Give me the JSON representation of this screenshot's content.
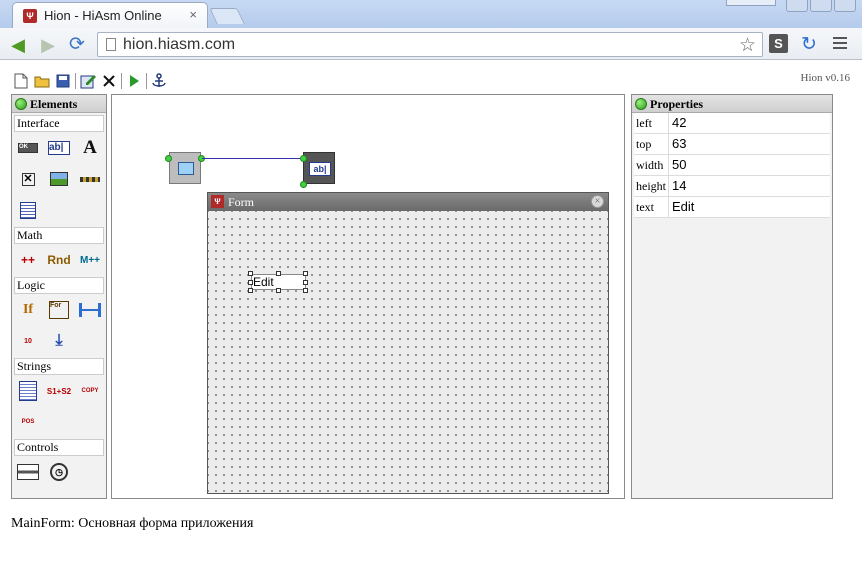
{
  "browser": {
    "tab_title": "Hion - HiAsm Online",
    "tab_close": "×",
    "favicon": "Ψ",
    "url": "hion.hiasm.com",
    "ext_label": "S"
  },
  "app": {
    "version": "Hion v0.16",
    "toolbar": [
      "new-file-icon",
      "open-folder-icon",
      "save-icon",
      "edit-icon",
      "delete-icon",
      "run-icon",
      "anchor-icon"
    ]
  },
  "elements_panel": {
    "title": "Elements",
    "groups": [
      {
        "label": "Interface"
      },
      {
        "label": "Math"
      },
      {
        "label": "Logic"
      },
      {
        "label": "Strings"
      },
      {
        "label": "Controls"
      }
    ],
    "icon_texts": {
      "button": "OK",
      "edit": "ab|",
      "label": "A",
      "check": "✕",
      "inc": "++",
      "rnd": "Rnd",
      "mpp": "M++",
      "if": "If",
      "for": "For",
      "ruler": "10",
      "s1s2": "S1+S2",
      "copy": "COPY",
      "pos": "POS"
    }
  },
  "canvas": {
    "edit_element_label": "ab|",
    "form_window": {
      "title": "Form",
      "edit_text": "Edit"
    }
  },
  "properties_panel": {
    "title": "Properties",
    "rows": [
      {
        "name": "left",
        "value": "42"
      },
      {
        "name": "top",
        "value": "63"
      },
      {
        "name": "width",
        "value": "50"
      },
      {
        "name": "height",
        "value": "14"
      },
      {
        "name": "text",
        "value": "Edit"
      }
    ]
  },
  "status": "MainForm: Основная форма приложения",
  "colors": {
    "accent_green": "#3fd13f",
    "link_line": "#3333aa",
    "titlebar_gray": "#6a6a6a"
  }
}
